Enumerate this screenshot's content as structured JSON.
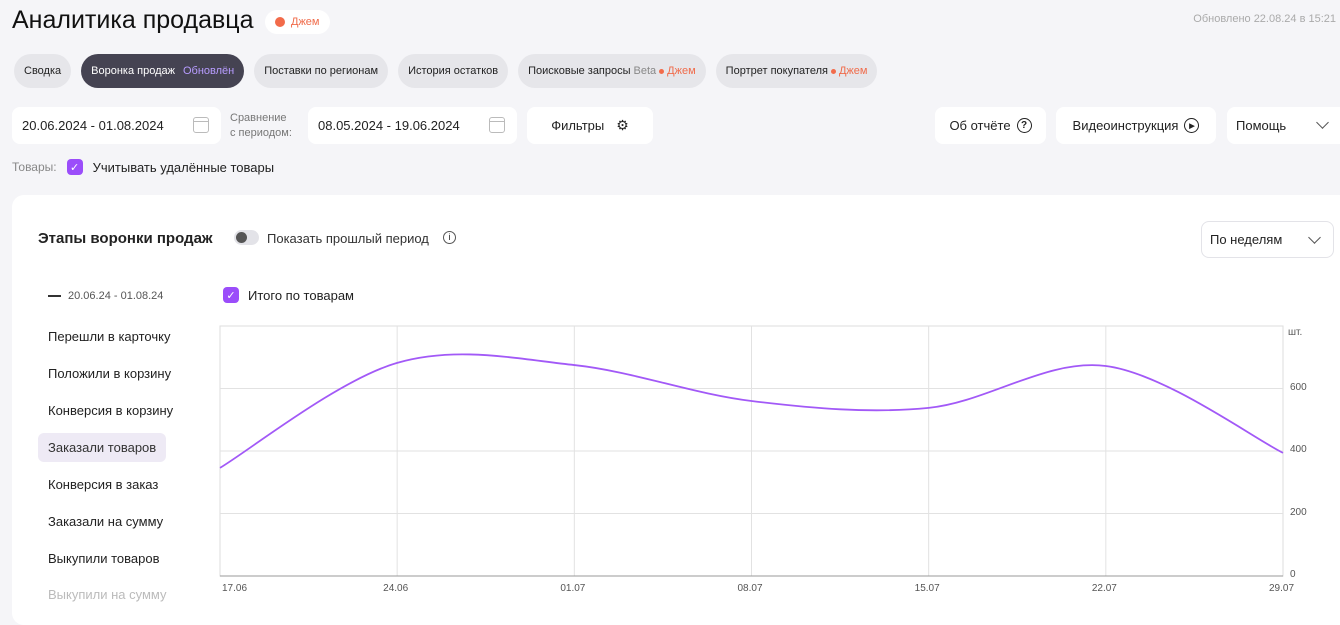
{
  "header": {
    "title": "Аналитика продавца",
    "badge": "Джем",
    "updated": "Обновлено 22.08.24 в 15:21"
  },
  "tabs": [
    {
      "label": "Сводка"
    },
    {
      "label": "Воронка продаж",
      "extra": "Обновлён"
    },
    {
      "label": "Поставки по регионам"
    },
    {
      "label": "История остатков"
    },
    {
      "label": "Поисковые запросы",
      "beta": "Beta",
      "jam": "Джем"
    },
    {
      "label": "Портрет покупателя",
      "jam": "Джем"
    }
  ],
  "toolbar": {
    "period": "20.06.2024 - 01.08.2024",
    "compare_label_1": "Сравнение",
    "compare_label_2": "с периодом:",
    "compare_period": "08.05.2024 - 19.06.2024",
    "filters": "Фильтры",
    "about": "Об отчёте",
    "video": "Видеоинструкция",
    "help": "Помощь"
  },
  "goods": {
    "label": "Товары:",
    "deleted": "Учитывать удалённые товары"
  },
  "card": {
    "title": "Этапы воронки продаж",
    "toggle": "Показать прошлый период",
    "group": "По неделям",
    "legend_period": "20.06.24 - 01.08.24",
    "total": "Итого по товарам",
    "metrics": [
      "Перешли в карточку",
      "Положили в корзину",
      "Конверсия в корзину",
      "Заказали товаров",
      "Конверсия в заказ",
      "Заказали на сумму",
      "Выкупили товаров",
      "Выкупили на сумму"
    ],
    "active_metric": 3
  },
  "colors": {
    "accent": "#9b4dfa",
    "jam": "#f06b4a"
  },
  "chart_data": {
    "type": "line",
    "categories": [
      "17.06",
      "24.06",
      "01.07",
      "08.07",
      "15.07",
      "22.07",
      "29.07"
    ],
    "series": [
      {
        "name": "Итого по товарам",
        "values": [
          346,
          682,
          675,
          560,
          538,
          672,
          394
        ]
      }
    ],
    "ylabel": "шт.",
    "yticks": [
      "0",
      "200",
      "400",
      "600"
    ],
    "ylim": [
      0,
      800
    ],
    "grid": true
  }
}
